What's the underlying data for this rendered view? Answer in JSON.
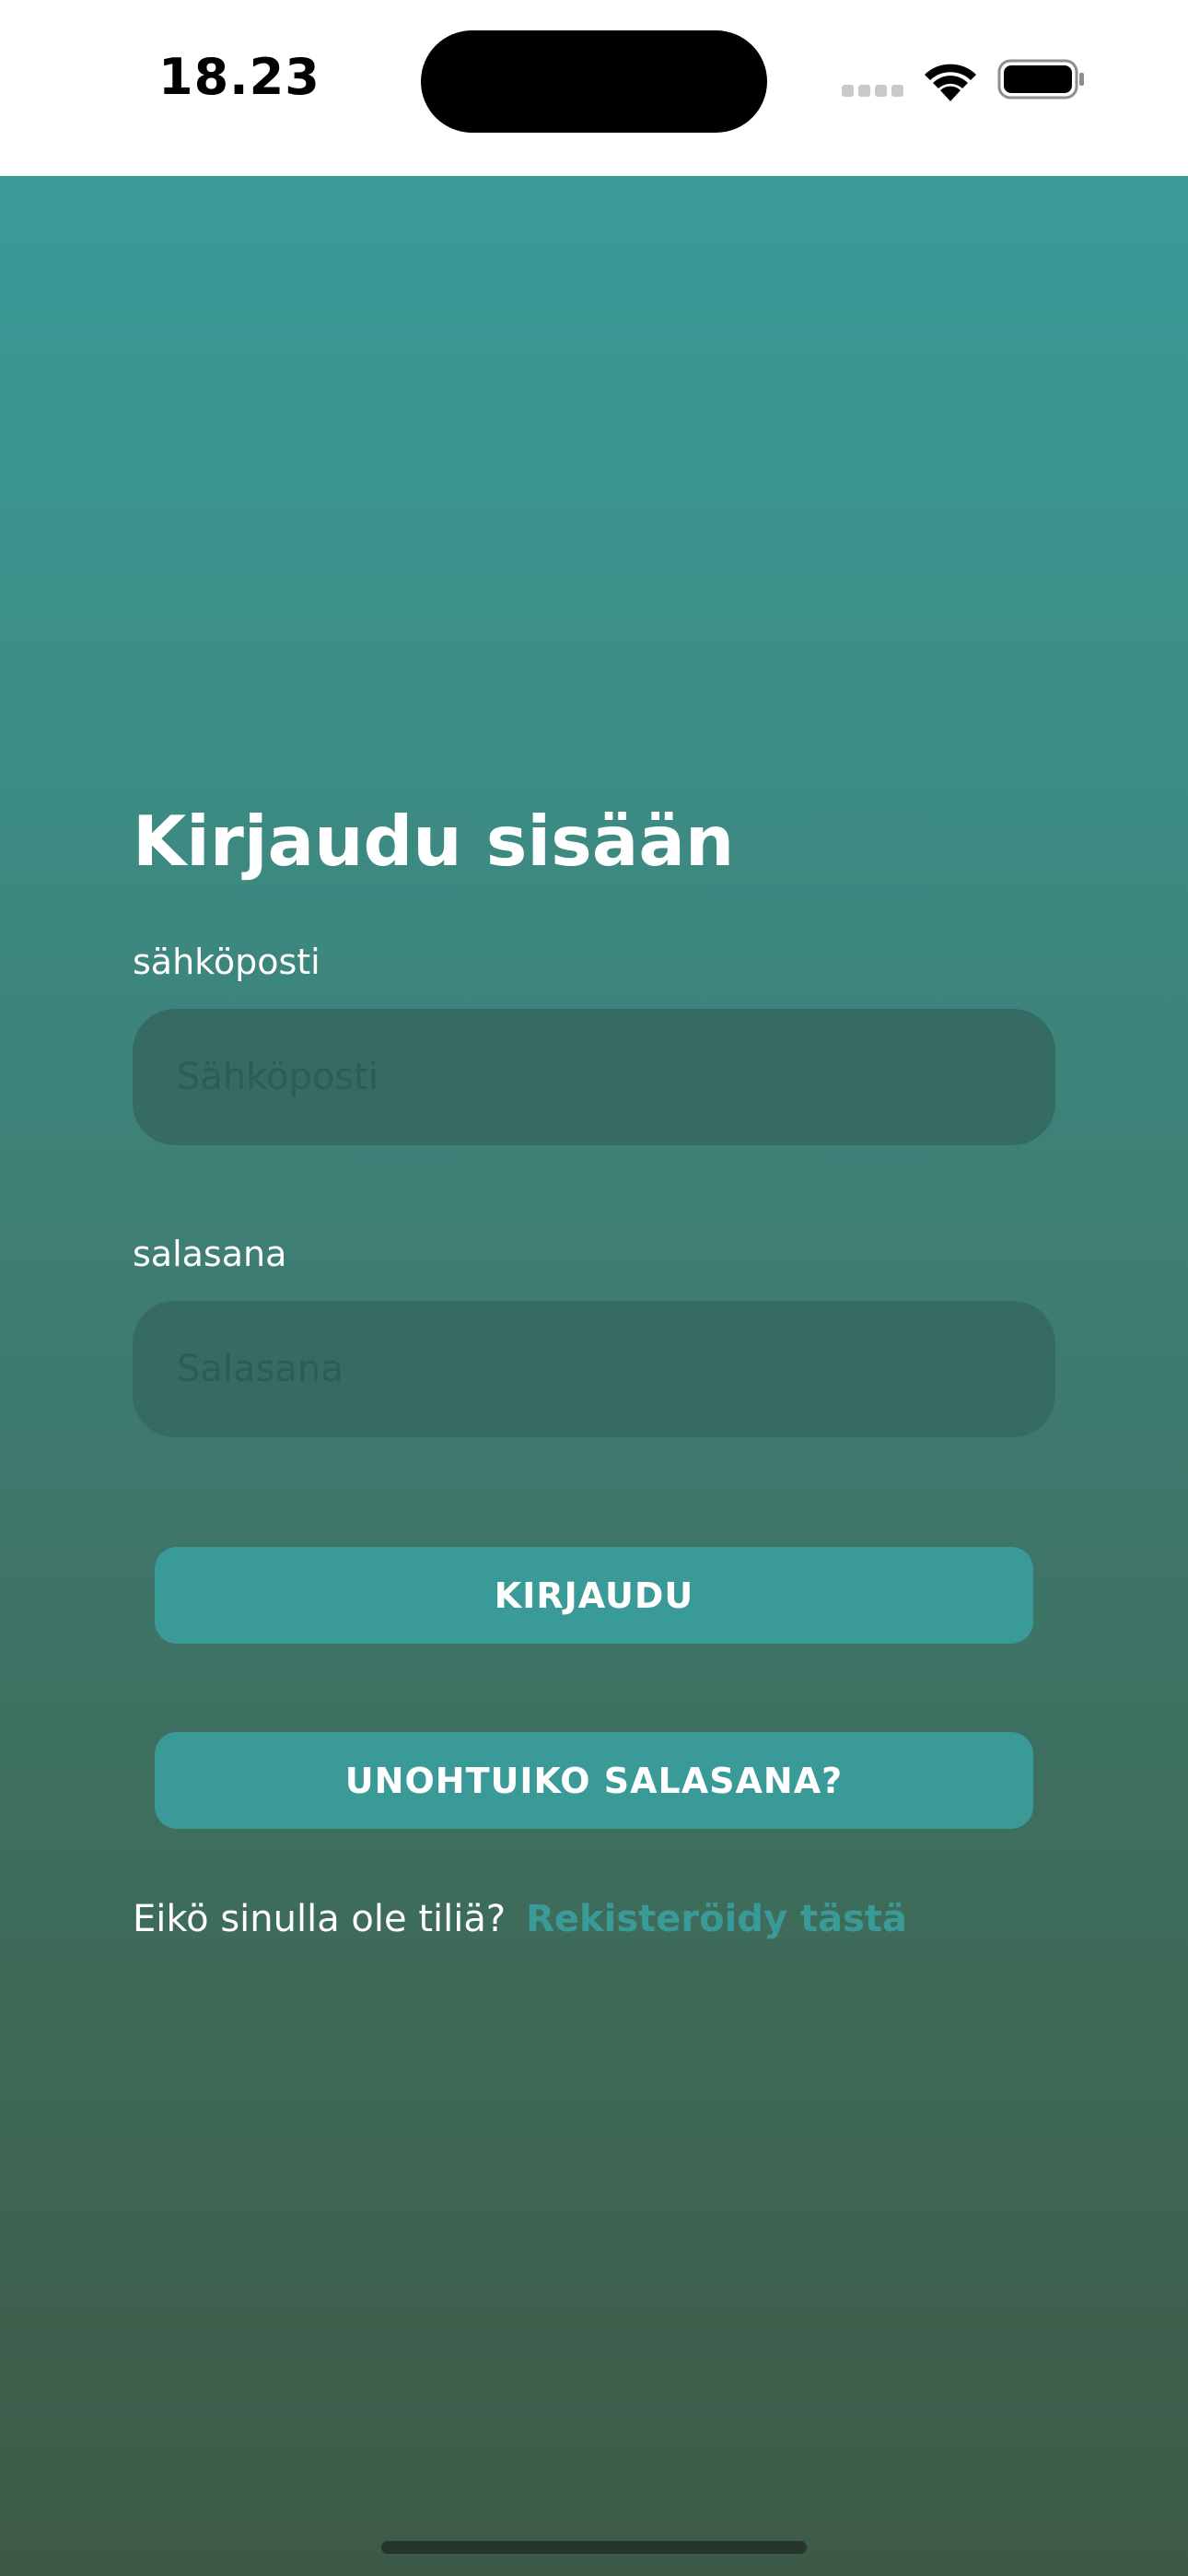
{
  "status_bar": {
    "time": "18.23",
    "signal_icon": "cellular-signal-icon",
    "wifi_icon": "wifi-icon",
    "battery_icon": "battery-icon"
  },
  "login": {
    "title": "Kirjaudu sisään",
    "email_label": "sähköposti",
    "email_placeholder": "Sähköposti",
    "email_value": "",
    "password_label": "salasana",
    "password_placeholder": "Salasana",
    "password_value": "",
    "login_button": "KIRJAUDU",
    "forgot_button": "UNOHTUIKO SALASANA?",
    "register_prompt": "Eikö sinulla ole tiliä?",
    "register_link": "Rekisteröidy tästä"
  },
  "colors": {
    "gradient_top": "#3a9b98",
    "gradient_bottom": "#3d5a47",
    "accent": "#3a9a97",
    "input_background": "#366b64",
    "text": "#ffffff"
  }
}
